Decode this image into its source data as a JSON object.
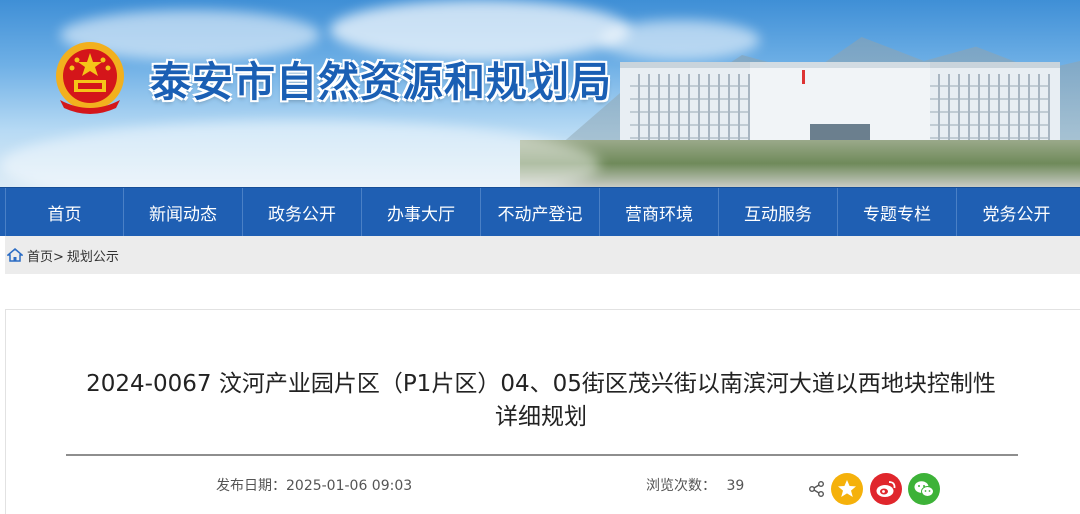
{
  "header": {
    "site_title": "泰安市自然资源和规划局",
    "emblem_icon": "national-emblem-icon",
    "brand_color": "#1a5fb4"
  },
  "nav": {
    "items": [
      {
        "label": "首页"
      },
      {
        "label": "新闻动态"
      },
      {
        "label": "政务公开"
      },
      {
        "label": "办事大厅"
      },
      {
        "label": "不动产登记"
      },
      {
        "label": "营商环境"
      },
      {
        "label": "互动服务"
      },
      {
        "label": "专题专栏"
      },
      {
        "label": "党务公开"
      }
    ],
    "background_color": "#1f5fb3"
  },
  "breadcrumb": {
    "home_icon": "home-icon",
    "home_label": "首页>",
    "current_label": "规划公示"
  },
  "article": {
    "title_line1": "2024-0067 汶河产业园片区（P1片区）04、05街区茂兴街以南滨河大道以西地块控制性",
    "title_line2": "详细规划",
    "publish_date_label": "发布日期：2025-01-06 09:03",
    "views_label": "浏览次数：",
    "views_count": "39"
  },
  "share": {
    "share_icon": "share-icon",
    "buttons": [
      {
        "name": "qzone-icon",
        "color": "#f5b10b"
      },
      {
        "name": "weibo-icon",
        "color": "#e0262c"
      },
      {
        "name": "wechat-icon",
        "color": "#3db238"
      }
    ]
  }
}
